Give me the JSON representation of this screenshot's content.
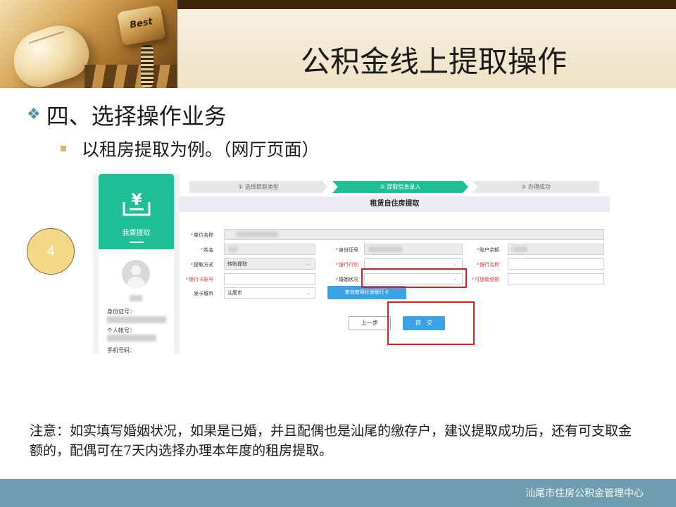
{
  "slide": {
    "title": "公积金线上提取操作",
    "header_key_text": "Best",
    "bullet1": "四、选择操作业务",
    "bullet1_marker": "❖",
    "bullet2": "以租房提取为例。（网厅页面）",
    "step_number": "4",
    "note": "注意：如实填写婚姻状况，如果是已婚，并且配偶也是汕尾的缴存户，建议提取成功后，还有可支取金额的，配偶可在7天内选择办理本年度的租房提取。",
    "footer": "汕尾市住房公积金管理中心"
  },
  "sidebar": {
    "icon": "yen-basket-icon",
    "menu_label": "我要提取",
    "fields": [
      "身份证号：",
      "个人帐号：",
      "手机号码："
    ]
  },
  "steps": [
    {
      "label": "① 选择提取类型",
      "active": false
    },
    {
      "label": "② 提取信息录入",
      "active": true
    },
    {
      "label": "③ 办理成功",
      "active": false
    }
  ],
  "form": {
    "title": "租赁自住房提取",
    "labels": {
      "unit_name": "单位名称",
      "name": "姓名",
      "id_no": "身份证号",
      "balance": "账户余额",
      "method": "提取方式",
      "bank": "银行行别",
      "bank_name": "银行名称",
      "card_no": "银行卡帐号",
      "marriage": "婚姻状况",
      "amount": "可提取金额",
      "card_city": "发卡城市"
    },
    "values": {
      "method": "转账提取",
      "card_city": "汕尾市"
    },
    "buttons": {
      "social_card": "查询使用社保银行卡",
      "prev": "上一步",
      "submit": "提　交"
    },
    "colors": {
      "accent": "#1fbf96",
      "button": "#3aa3e8",
      "highlight": "#e11d1d"
    }
  }
}
